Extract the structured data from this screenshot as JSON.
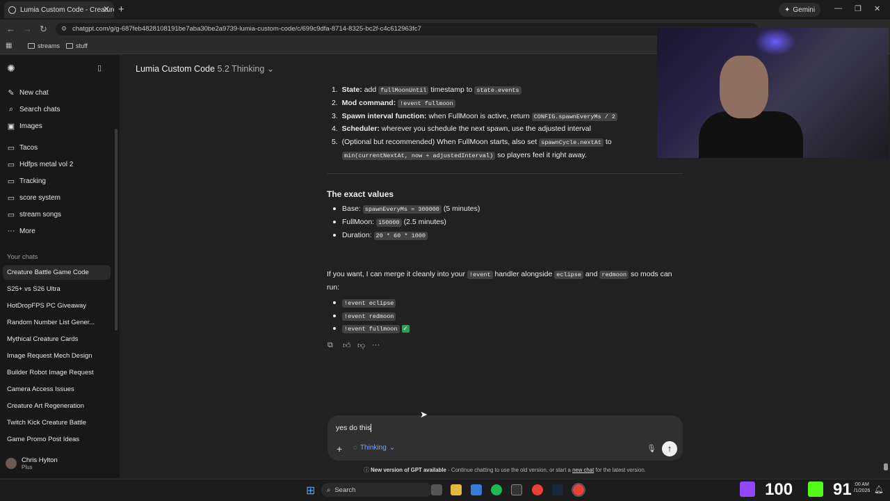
{
  "browser": {
    "tab_title": "Lumia Custom Code - Creature",
    "new_tab": "+",
    "gemini_label": "Gemini",
    "url": "chatgpt.com/g/g-687feb4828108191be7aba30be2a9739-lumia-custom-code/c/699c9dfa-8714-8325-bc2f-c4c612963fc7",
    "bookmarks": [
      "streams",
      "stuff"
    ]
  },
  "sidebar": {
    "top_items": [
      {
        "label": "New chat",
        "icon": "edit-icon"
      },
      {
        "label": "Search chats",
        "icon": "search-icon"
      },
      {
        "label": "Images",
        "icon": "image-icon"
      }
    ],
    "projects": [
      "Tacos",
      "Hdfps metal vol 2",
      "Tracking",
      "score system",
      "stream songs"
    ],
    "more_label": "More",
    "your_chats_label": "Your chats",
    "chats": [
      "Creature Battle Game Code",
      "S25+ vs S26 Ultra",
      "HotDropFPS PC Giveaway",
      "Random Number List Gener...",
      "Mythical Creature Cards",
      "Image Request Mech Design",
      "Builder Robot Image Request",
      "Camera Access Issues",
      "Creature Art Regeneration",
      "Twitch Kick Creature Battle",
      "Game Promo Post Ideas"
    ],
    "user": {
      "name": "Chris Hylton",
      "plan": "Plus"
    }
  },
  "header": {
    "title": "Lumia Custom Code",
    "model": "5.2 Thinking"
  },
  "message": {
    "steps": [
      {
        "num": "1.",
        "bold": "State:",
        "pre": " add ",
        "code1": "fullMoonUntil",
        "post": " timestamp to ",
        "code2": "state.events"
      },
      {
        "num": "2.",
        "bold": "Mod command:",
        "code1": "!event fullmoon"
      },
      {
        "num": "3.",
        "bold": "Spawn interval function:",
        "pre": " when FullMoon is active, return ",
        "code1": "CONFIG.spawnEveryMs / 2"
      },
      {
        "num": "4.",
        "bold": "Scheduler:",
        "pre": " wherever you schedule the next spawn, use the adjusted interval"
      },
      {
        "num": "5.",
        "pre": "(Optional but recommended) When FullMoon starts, also set ",
        "code1": "spawnCycle.nextAt",
        "post": " to",
        "line2_code": "min(currentNextAt, now + adjustedInterval)",
        "line2_post": " so players feel it right away."
      }
    ],
    "exact_heading": "The exact values",
    "values": [
      {
        "label": "Base:",
        "code": "spawnEveryMs = 300000",
        "note": "(5 minutes)"
      },
      {
        "label": "FullMoon:",
        "code": "150000",
        "note": "(2.5 minutes)"
      },
      {
        "label": "Duration:",
        "code": "20 * 60 * 1000",
        "note": ""
      }
    ],
    "merge_text_1": "If you want, I can merge it cleanly into your ",
    "merge_code_1": "!event",
    "merge_text_2": " handler alongside ",
    "merge_code_2": "eclipse",
    "merge_text_3": " and ",
    "merge_code_3": "redmoon",
    "merge_text_4": " so mods can",
    "merge_text_line2": "run:",
    "commands": [
      "!event eclipse",
      "!event redmoon",
      "!event fullmoon"
    ],
    "check_mark": "✓"
  },
  "composer": {
    "value": "yes do this",
    "mode_label": "Thinking"
  },
  "notice": {
    "bold": "New version of GPT available",
    "text": " - Continue chatting to use the old version, or start a ",
    "link": "new chat",
    "tail": " for the latest version."
  },
  "taskbar": {
    "search_label": "Search",
    "stat_1": "100",
    "stat_2": "91",
    "clock_time": ":00 AM",
    "clock_date": "/1/2026"
  }
}
